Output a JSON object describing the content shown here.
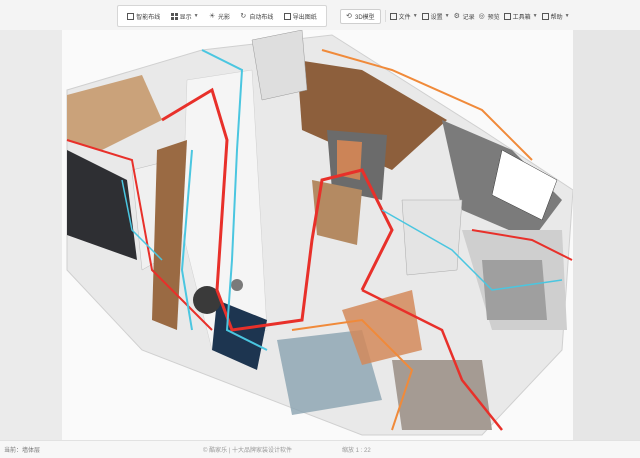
{
  "toolbar": {
    "group_a": [
      {
        "label": "智能布线",
        "icon": "wiring-icon"
      },
      {
        "label": "显示",
        "icon": "grid-icon",
        "has_caret": true
      },
      {
        "label": "光影",
        "icon": "light-icon"
      },
      {
        "label": "自动布线",
        "icon": "auto-route-icon"
      },
      {
        "label": "导出图纸",
        "icon": "export-icon"
      }
    ],
    "group_b": {
      "view3d": "3D模型",
      "file": "文件",
      "settings": "设置",
      "record": "记录",
      "preview": "预览",
      "tools": "工具箱",
      "help": "帮助"
    }
  },
  "status": {
    "left": "当前：墙体层",
    "middle": "© 酷家乐 | 十大品牌家装设计软件",
    "right": "缩放 1 : 22"
  },
  "colors": {
    "toolbar_bg": "#ffffff",
    "viewport_bg": "#fafafa",
    "wire_red": "#e8302a",
    "wire_cyan": "#4ac6e0",
    "wire_orange": "#f08a3a",
    "wire_navy": "#1b3a5b"
  }
}
